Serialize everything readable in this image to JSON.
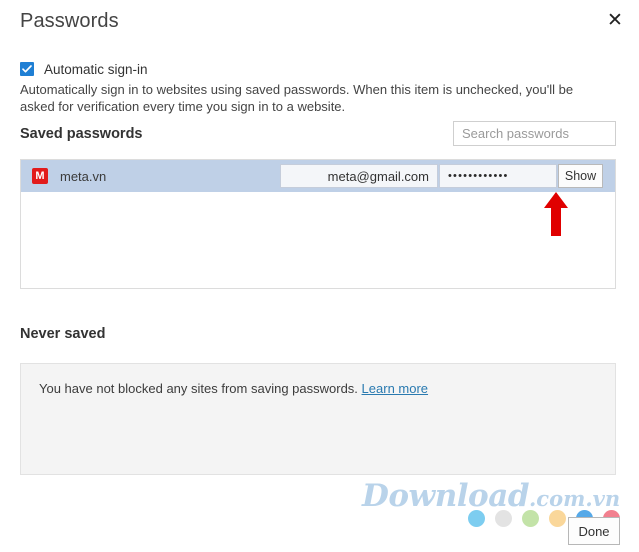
{
  "header": {
    "title": "Passwords",
    "close_label": "✕"
  },
  "auto_signin": {
    "checked": true,
    "label": "Automatic sign-in",
    "description": "Automatically sign in to websites using saved passwords. When this item is unchecked, you'll be asked for verification every time you sign in to a website."
  },
  "saved": {
    "heading": "Saved passwords",
    "search_placeholder": "Search passwords",
    "search_value": "",
    "rows": [
      {
        "favicon_letter": "M",
        "favicon_color": "#e21b1b",
        "site": "meta.vn",
        "username": "meta@gmail.com",
        "password_mask": "••••••••••••",
        "show_label": "Show",
        "selected": true
      }
    ]
  },
  "never_saved": {
    "heading": "Never saved",
    "message": "You have not blocked any sites from saving passwords.",
    "link_label": "Learn more"
  },
  "watermark": {
    "main": "Download",
    "tld": ".com.vn"
  },
  "dots": [
    "#7dcdf0",
    "#e3e3e3",
    "#c3e3a8",
    "#fad79a",
    "#56a9e8",
    "#f2808f"
  ],
  "footer": {
    "done_label": "Done"
  },
  "colors": {
    "accent": "#1f7fd4",
    "row_selected": "#bfd0e7",
    "annotation_red": "#e00000",
    "link": "#2a7ab0"
  }
}
